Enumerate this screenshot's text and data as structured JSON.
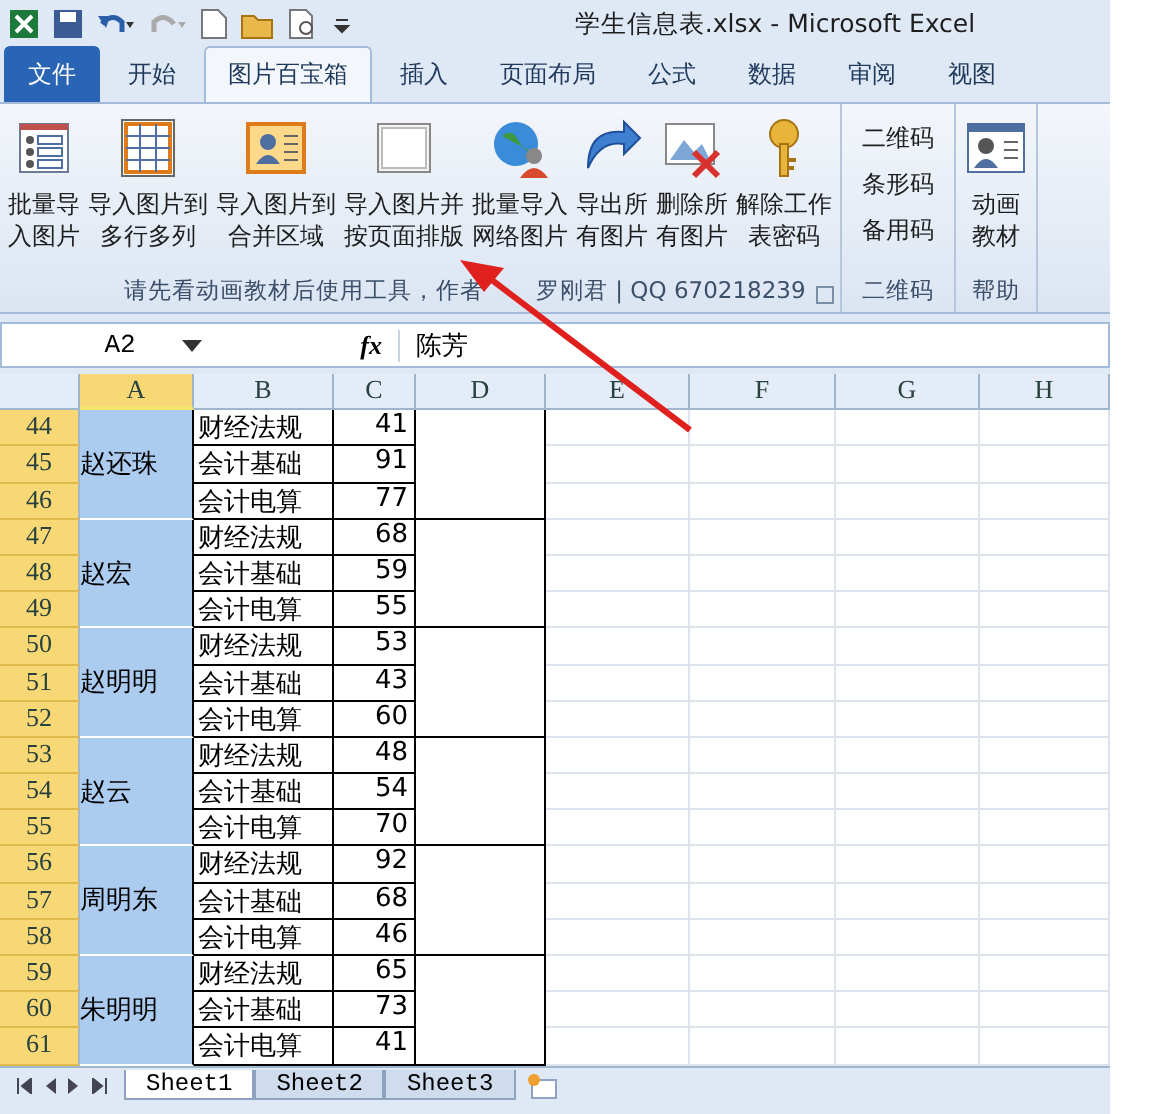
{
  "window": {
    "title": "学生信息表.xlsx  -  Microsoft Excel"
  },
  "tabs": [
    {
      "label": "文件",
      "kind": "file",
      "selected": false
    },
    {
      "label": "开始",
      "kind": "tab",
      "selected": false
    },
    {
      "label": "图片百宝箱",
      "kind": "tab",
      "selected": true
    },
    {
      "label": "插入",
      "kind": "tab",
      "selected": false
    },
    {
      "label": "页面布局",
      "kind": "tab",
      "selected": false
    },
    {
      "label": "公式",
      "kind": "tab",
      "selected": false
    },
    {
      "label": "数据",
      "kind": "tab",
      "selected": false
    },
    {
      "label": "审阅",
      "kind": "tab",
      "selected": false
    },
    {
      "label": "视图",
      "kind": "tab",
      "selected": false
    }
  ],
  "ribbon": {
    "groups": [
      {
        "label_parts": [
          "请先看动画教材后使用工具，作者",
          "罗刚君 | QQ 670218239"
        ],
        "kind": "large",
        "buttons": [
          {
            "lines": [
              "批量导",
              "入图片"
            ]
          },
          {
            "lines": [
              "导入图片到",
              "多行多列"
            ]
          },
          {
            "lines": [
              "导入图片到",
              "合并区域"
            ]
          },
          {
            "lines": [
              "导入图片并",
              "按页面排版"
            ]
          },
          {
            "lines": [
              "批量导入",
              "网络图片"
            ]
          },
          {
            "lines": [
              "导出所",
              "有图片"
            ]
          },
          {
            "lines": [
              "删除所",
              "有图片"
            ]
          },
          {
            "lines": [
              "解除工作",
              "表密码"
            ]
          }
        ]
      },
      {
        "label": "二维码",
        "kind": "small",
        "buttons": [
          {
            "lines": [
              "二维码"
            ]
          },
          {
            "lines": [
              "条形码"
            ]
          },
          {
            "lines": [
              "备用码"
            ]
          }
        ]
      },
      {
        "label": "帮助",
        "kind": "large",
        "buttons": [
          {
            "lines": [
              "动画",
              "教材"
            ]
          }
        ]
      }
    ]
  },
  "formula_bar": {
    "name_box": "A2",
    "fx": "fx",
    "value": "陈芳"
  },
  "columns": [
    {
      "label": "A",
      "selected": true
    },
    {
      "label": "B",
      "selected": false
    },
    {
      "label": "C",
      "selected": false
    },
    {
      "label": "D",
      "selected": false
    },
    {
      "label": "E",
      "selected": false
    },
    {
      "label": "F",
      "selected": false
    },
    {
      "label": "G",
      "selected": false
    },
    {
      "label": "H",
      "selected": false
    }
  ],
  "students": [
    {
      "name": "赵还珠",
      "rows": [
        {
          "number": "44",
          "subject": "财经法规",
          "score": "41"
        },
        {
          "number": "45",
          "subject": "会计基础",
          "score": "91"
        },
        {
          "number": "46",
          "subject": "会计电算",
          "score": "77"
        }
      ]
    },
    {
      "name": "赵宏",
      "rows": [
        {
          "number": "47",
          "subject": "财经法规",
          "score": "68"
        },
        {
          "number": "48",
          "subject": "会计基础",
          "score": "59"
        },
        {
          "number": "49",
          "subject": "会计电算",
          "score": "55"
        }
      ]
    },
    {
      "name": "赵明明",
      "rows": [
        {
          "number": "50",
          "subject": "财经法规",
          "score": "53"
        },
        {
          "number": "51",
          "subject": "会计基础",
          "score": "43"
        },
        {
          "number": "52",
          "subject": "会计电算",
          "score": "60"
        }
      ]
    },
    {
      "name": "赵云",
      "rows": [
        {
          "number": "53",
          "subject": "财经法规",
          "score": "48"
        },
        {
          "number": "54",
          "subject": "会计基础",
          "score": "54"
        },
        {
          "number": "55",
          "subject": "会计电算",
          "score": "70"
        }
      ]
    },
    {
      "name": "周明东",
      "rows": [
        {
          "number": "56",
          "subject": "财经法规",
          "score": "92"
        },
        {
          "number": "57",
          "subject": "会计基础",
          "score": "68"
        },
        {
          "number": "58",
          "subject": "会计电算",
          "score": "46"
        }
      ]
    },
    {
      "name": "朱明明",
      "rows": [
        {
          "number": "59",
          "subject": "财经法规",
          "score": "65"
        },
        {
          "number": "60",
          "subject": "会计基础",
          "score": "73"
        },
        {
          "number": "61",
          "subject": "会计电算",
          "score": "41"
        }
      ]
    }
  ],
  "sheet_tabs": [
    {
      "label": "Sheet1",
      "selected": true
    },
    {
      "label": "Sheet2",
      "selected": false
    },
    {
      "label": "Sheet3",
      "selected": false
    }
  ]
}
